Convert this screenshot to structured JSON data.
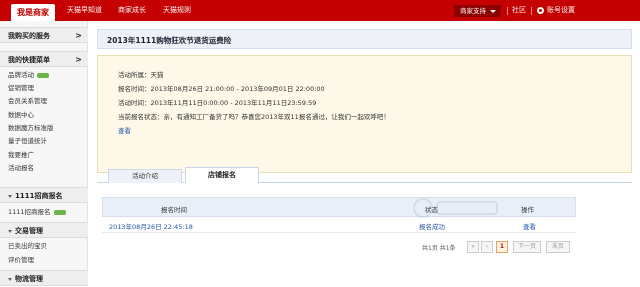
{
  "topbar": {
    "brand": "我是商家",
    "nav": [
      "天猫早知道",
      "商家成长",
      "天猫规则"
    ],
    "support_label": "商家支持",
    "community_label": "社区",
    "account_settings_label": "账号设置"
  },
  "sidebar": {
    "sections": [
      {
        "title": "我购买的服务",
        "items": []
      },
      {
        "title": "我的快捷菜单",
        "items": [
          "品牌活动",
          "促销管理",
          "会员关系管理",
          "数据中心",
          "数据魔方标准版",
          "量子恒道统计",
          "我要推广",
          "活动报名"
        ]
      },
      {
        "title": "1111招商报名",
        "items": [
          "1111招商报名"
        ]
      },
      {
        "title": "交易管理",
        "items": [
          "已卖出的宝贝",
          "评价管理"
        ]
      },
      {
        "title": "物流管理",
        "items": []
      }
    ],
    "arrow": ">"
  },
  "main": {
    "title": "2013年1111购物狂欢节退货运费险",
    "info": {
      "activity": "活动所属：天猫",
      "signup_time": "报名时间：2013年08月26日 21:00:00 - 2013年09月01日 22:00:00",
      "activity_time": "活动时间：2013年11月11日0:00:00 - 2013年11月11日23:59:59",
      "status": "当前报名状态：亲，有通知工厂备货了吗？恭喜您2013年双11报名通过，让我们一起欢呼吧！",
      "view_link": "查看"
    },
    "tabs": [
      "活动介绍",
      "店铺报名"
    ],
    "table": {
      "headers": [
        "报名时间",
        "状态",
        "操作"
      ],
      "rows": [
        {
          "time": "2013年08月26日 22:45:18",
          "status": "报名成功",
          "action": "查看"
        }
      ]
    },
    "pager": {
      "summary": "共1页 共1条",
      "first": "«",
      "prev": "‹",
      "current": "1",
      "next": "下一页",
      "last": "末页"
    }
  },
  "colors": {
    "brand_red": "#c40000",
    "link_blue": "#2255aa",
    "info_bg": "#fdf8e8"
  }
}
